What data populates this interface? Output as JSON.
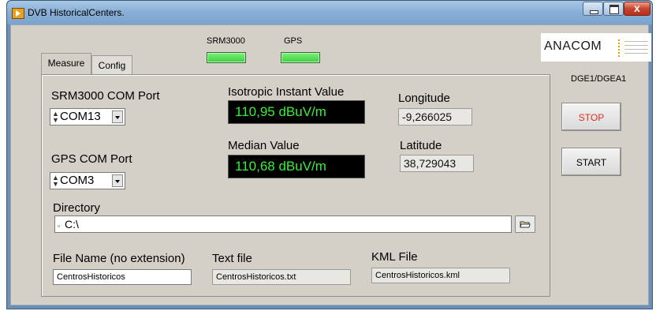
{
  "window": {
    "title": "DVB HistoricalCenters."
  },
  "indicators": {
    "srm_label": "SRM3000",
    "gps_label": "GPS",
    "led_color": "#4fe04f"
  },
  "brand": {
    "logo_text": "ANACOM",
    "dept": "DGE1/DGEA1"
  },
  "buttons": {
    "stop": "STOP",
    "start": "START",
    "stop_color": "#d83020"
  },
  "tabs": [
    {
      "label": "Measure"
    },
    {
      "label": "Config"
    }
  ],
  "measure": {
    "srm_port_label": "SRM3000 COM Port",
    "srm_port_value": "COM13",
    "gps_port_label": "GPS COM Port",
    "gps_port_value": "COM3",
    "isotropic_label": "Isotropic Instant Value",
    "isotropic_value": "110,95 dBuV/m",
    "median_label": "Median Value",
    "median_value": "110,68 dBuV/m",
    "longitude_label": "Longitude",
    "longitude_value": "-9,266025",
    "latitude_label": "Latitude",
    "latitude_value": "38,729043",
    "directory_label": "Directory",
    "directory_value": "C:\\",
    "filename_label": "File Name (no extension)",
    "filename_value": "CentrosHistoricos",
    "textfile_label": "Text file",
    "textfile_value": "CentrosHistoricos.txt",
    "kml_label": "KML File",
    "kml_value": "CentrosHistoricos.kml"
  }
}
